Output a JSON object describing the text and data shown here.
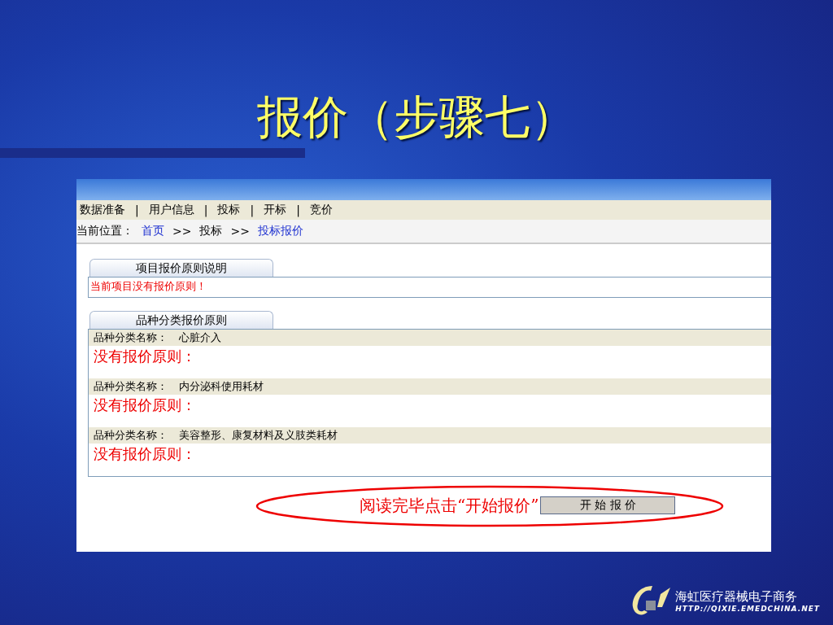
{
  "slide_title": "报价（步骤七）",
  "menu": {
    "items": [
      {
        "label": "数据准备"
      },
      {
        "label": "用户信息"
      },
      {
        "label": "投标"
      },
      {
        "label": "开标"
      },
      {
        "label": "竞价"
      }
    ],
    "separator": "|"
  },
  "breadcrumb": {
    "label": "当前位置：",
    "parts": [
      {
        "kind": "link",
        "text": "首页"
      },
      {
        "kind": "separator",
        "text": ">>"
      },
      {
        "kind": "plain",
        "text": "投标"
      },
      {
        "kind": "separator",
        "text": ">>"
      },
      {
        "kind": "link",
        "text": "投标报价"
      }
    ]
  },
  "project_rules": {
    "tab": "项目报价原则说明",
    "message": "当前项目没有报价原则！"
  },
  "category_rules": {
    "tab": "品种分类报价原则",
    "items": [
      {
        "label": "品种分类名称：",
        "name": "心脏介入",
        "rule": "没有报价原则："
      },
      {
        "label": "品种分类名称：",
        "name": "内分泌科使用耗材",
        "rule": "没有报价原则："
      },
      {
        "label": "品种分类名称：",
        "name": "美容整形、康复材料及义肢类耗材",
        "rule": "没有报价原则："
      }
    ]
  },
  "callout": {
    "text": "阅读完毕点击“开始报价”",
    "button": "开 始 报 价"
  },
  "logo": {
    "name": "海虹医疗器械电子商务",
    "url": "HTTP://QIXIE.EMEDCHINA.NET"
  }
}
